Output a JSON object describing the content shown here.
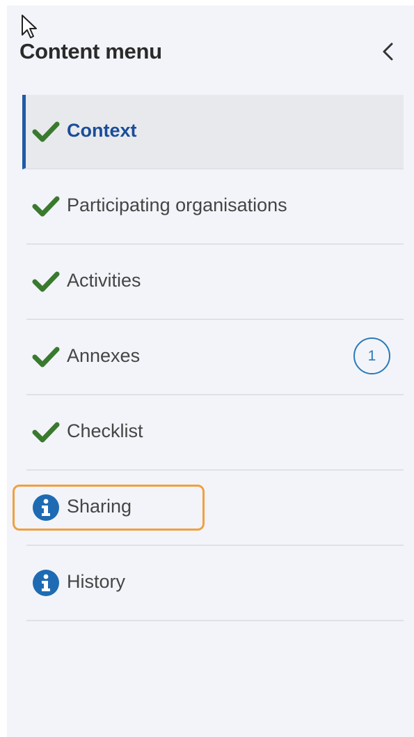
{
  "colors": {
    "panel_bg": "#f3f4f9",
    "active_bg": "#e8e9ed",
    "active_accent": "#1e5aa8",
    "check_green": "#3a7a2e",
    "info_blue": "#1e6bb3",
    "badge_blue": "#2a7ab8",
    "highlight_orange": "#f0a040"
  },
  "menu": {
    "title": "Content menu",
    "collapse_icon": "chevron-left-icon",
    "items": [
      {
        "label": "Context",
        "status_icon": "checkmark-icon",
        "active": true
      },
      {
        "label": "Participating organisations",
        "status_icon": "checkmark-icon"
      },
      {
        "label": "Activities",
        "status_icon": "checkmark-icon"
      },
      {
        "label": "Annexes",
        "status_icon": "checkmark-icon",
        "badge": "1"
      },
      {
        "label": "Checklist",
        "status_icon": "checkmark-icon"
      },
      {
        "label": "Sharing",
        "status_icon": "info-icon",
        "highlighted": true
      },
      {
        "label": "History",
        "status_icon": "info-icon"
      }
    ]
  }
}
